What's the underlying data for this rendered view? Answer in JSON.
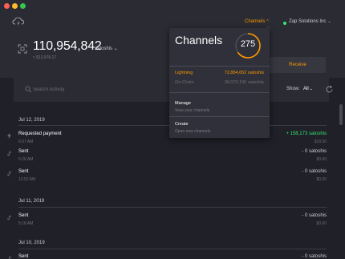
{
  "header": {
    "channels_nav": "Channels",
    "node_name": "Zap Solutions Inc",
    "balance": "110,954,842",
    "balance_unit": "satoshis",
    "balance_fiat": "≈ $12,978.17",
    "receive_label": "Receive"
  },
  "search": {
    "placeholder": "Search Activity",
    "show_label": "Show:",
    "show_value": "All"
  },
  "activity": {
    "groups": [
      {
        "date": "Jul 12, 2019",
        "items": [
          {
            "title": "Requested payment",
            "time": "6:07 AM",
            "amount": "+ 158,173 satoshis",
            "fiat": "$18.50",
            "icon": "lightning-icon"
          },
          {
            "title": "Sent",
            "time": "6:26 AM",
            "amount": "- 0 satoshis",
            "fiat": "$0.00",
            "icon": "link-icon"
          },
          {
            "title": "Sent",
            "time": "12:52 AM",
            "amount": "- 0 satoshis",
            "fiat": "$0.00",
            "icon": "link-icon"
          }
        ]
      },
      {
        "date": "Jul 11, 2019",
        "items": [
          {
            "title": "Sent",
            "time": "5:18 AM",
            "amount": "- 0 satoshis",
            "fiat": "$0.00",
            "icon": "link-icon"
          }
        ]
      },
      {
        "date": "Jul 10, 2019",
        "items": [
          {
            "title": "Sent",
            "time": "",
            "amount": "- 0 satoshis",
            "fiat": "",
            "icon": "link-icon"
          }
        ]
      }
    ]
  },
  "channels_popup": {
    "title": "Channels",
    "count": "275",
    "lightning_label": "Lightning",
    "lightning_value": "72,884,652 satoshis",
    "onchain_label": "On-Chain",
    "onchain_value": "38,070,190 satoshis",
    "manage_title": "Manage",
    "manage_sub": "View your channels",
    "create_title": "Create",
    "create_sub": "Open new channels"
  },
  "colors": {
    "accent": "#fd9800",
    "positive": "#39e673",
    "background": "#1f2028",
    "panel": "#2a2b33"
  }
}
